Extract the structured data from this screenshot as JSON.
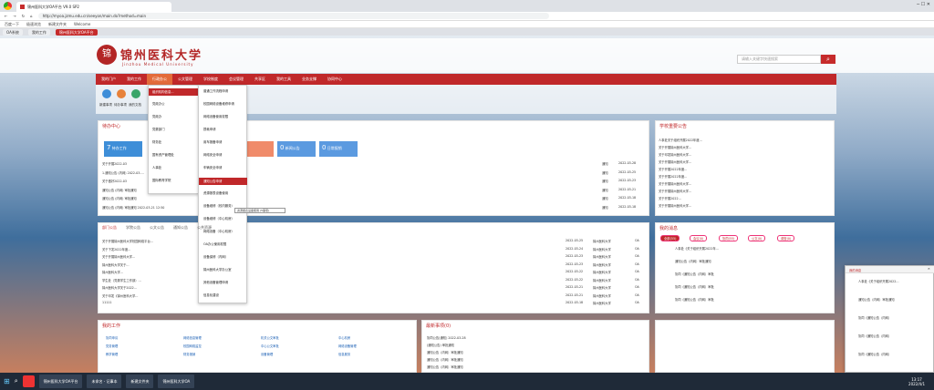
{
  "browser": {
    "tab_title": "锦州医科大学OA平台 V9.0 SP2",
    "url": "http://myoa.jzmu.edu.cn/seeyon/main.do?method=main",
    "bookmarks": [
      "百度一下",
      "极速浏览",
      "新建文件夹",
      "Welcome"
    ],
    "tabs2": [
      "OA系统",
      "我的工作",
      "锦州医科大学OA平台"
    ]
  },
  "header": {
    "logo_glyph": "锦",
    "title": "锦州医科大学",
    "subtitle": "Jinzhou Medical University",
    "search_placeholder": "请输入关键字快速搜索",
    "search_icon": "search-icon"
  },
  "menu": [
    "我的门户",
    "我的工作",
    "行政办公",
    "公文管理",
    "学校制度",
    "会议管理",
    "共享区",
    "我的工具",
    "业务支撑",
    "协同中心"
  ],
  "active_menu_index": 2,
  "quick": [
    "新建事项",
    "待办事项",
    "我的文档"
  ],
  "todo": {
    "title": "待办中心",
    "tiles": [
      {
        "label": "待办工作",
        "n": "7",
        "color": "#3e8ed8"
      },
      {
        "label": "",
        "n": "",
        "color": "#6aa6e2"
      },
      {
        "label": "",
        "n": "",
        "color": "#f08b6a"
      },
      {
        "label": "新闻公告",
        "n": "0",
        "color": "#5b9ae0"
      },
      {
        "label": "日常报销",
        "n": "0",
        "color": "#5b9ae0"
      }
    ],
    "rows": [
      [
        "关于开展2022-03",
        "2022-03-28",
        "通知"
      ],
      [
        "1.通知公告 (内网) 2022-03-...",
        "2022-03-25",
        "通知"
      ],
      [
        "关于做好2022-03",
        "2022-03-23",
        "通知"
      ],
      [
        "通知公告 (内网) 审批通知",
        "2022-03-21",
        "通知"
      ],
      [
        "通知公告 (内网) 审批通知",
        "2022-03-18",
        "通知"
      ],
      [
        "通知公告 (内网) 审批通知 2022-03-21 12:50",
        "2022-03-18",
        "通知"
      ]
    ]
  },
  "dropdown": [
    "组织机构信息...",
    "党政办公",
    "党政办",
    "党委部门",
    "财务处",
    "国有资产管理处",
    "人事处",
    "国际教育学院"
  ],
  "submenu": [
    "普通工作流程申请",
    "校园网络设备维修申请",
    "网络设备使用权限",
    "损耗申请",
    "用车报备申请",
    "网络安全申请",
    "车辆安全申请",
    "通知公告申请",
    "资源报表设备使用",
    "设备维修（校内服务）",
    "设备维修（中心机房）",
    "网络设备（中心机房）",
    "OA办公使用权限",
    "设备保修（内网）",
    "锦州医科大学办公室",
    "其他设备管理申请",
    "信息化建设"
  ],
  "submenu_hl_index": 7,
  "tooltip": "资源报表设备使用 (5事项)",
  "public": {
    "tabs": [
      "部门公告",
      "学院公告",
      "公文公告",
      "通知公告",
      "公共资源"
    ],
    "rows": [
      [
        "关于开展锦州医科大学校园网络平台...",
        "2022-03-25",
        "锦州医科大学",
        "OA"
      ],
      [
        "关于下发2022年度...",
        "2022-03-24",
        "锦州医科大学",
        "OA"
      ],
      [
        "关于开展锦州医科大学...",
        "2022-03-23",
        "锦州医科大学",
        "OA"
      ],
      [
        "锦州医科大学关于...",
        "2022-03-23",
        "锦州医科大学",
        "OA"
      ],
      [
        "锦州医科大学...",
        "2022-03-22",
        "锦州医科大学",
        "OA"
      ],
      [
        "学生处（党委学生工作部）...",
        "2022-03-22",
        "锦州医科大学",
        "OA"
      ],
      [
        "锦州医科大学关于2022...",
        "2022-03-21",
        "锦州医科大学",
        "OA"
      ],
      [
        "关于印发《锦州医科大学...",
        "2022-03-21",
        "锦州医科大学",
        "OA"
      ],
      [
        "11111",
        "2022-03-18",
        "锦州医科大学",
        "OA"
      ]
    ]
  },
  "news": {
    "title": "学校重要公告",
    "rows": [
      "人事处关于组织开展2022年度...",
      "关于开展锦州医科大学...",
      "关于印发锦州医科大学...",
      "关于开展锦州医科大学...",
      "关于开展2022年度...",
      "关于开展2022年度...",
      "关于开展锦州医科大学...",
      "关于开展锦州医科大学...",
      "关于开展2022...",
      "关于开展锦州医科大学..."
    ]
  },
  "myinfo": {
    "title": "我的消息",
    "tabs": [
      "全部(55)",
      "会议(0)",
      "协同(55)",
      "公文(0)",
      "调查(0)"
    ],
    "rows": [
      "人事处《关于组织开展2022年...",
      "通知公告（内网）审批通知",
      "协同《通知公告（内网）审批",
      "协同《通知公告（内网）审批",
      "协同《通知公告（内网）审批"
    ]
  },
  "works": {
    "title": "我的工作",
    "items": [
      "协同申请",
      "网络信息管理",
      "机关公文审批",
      "中心机房",
      "党务管理",
      "校园网络监控",
      "中心公文审批",
      "网络设备管理",
      "教学管理",
      "财务报销",
      "设备管理",
      "信息服务"
    ]
  },
  "events": {
    "title": "最新事项(0)",
    "rows": [
      "协同公告(通知) 2022-03-28",
      "(通知公告) 审批通知",
      "通知公告（内网）审批通知",
      "通知公告（内网）审批通知",
      "通知公告（内网）审批通知"
    ]
  },
  "popup": {
    "title": "我的消息",
    "items": [
      "人事处《关于组织开展2022...",
      "通知公告（内网）审批通知",
      "协同《通知公告（内网）",
      "协同《通知公告（内网）",
      "协同《通知公告（内网）"
    ]
  },
  "taskbar": [
    "锦州医科大学OA平台",
    "未命名 - 记事本",
    "新建文件夹",
    "锦州医科大学OA"
  ],
  "clock": {
    "time": "13:17",
    "date": "2022/4/1"
  }
}
